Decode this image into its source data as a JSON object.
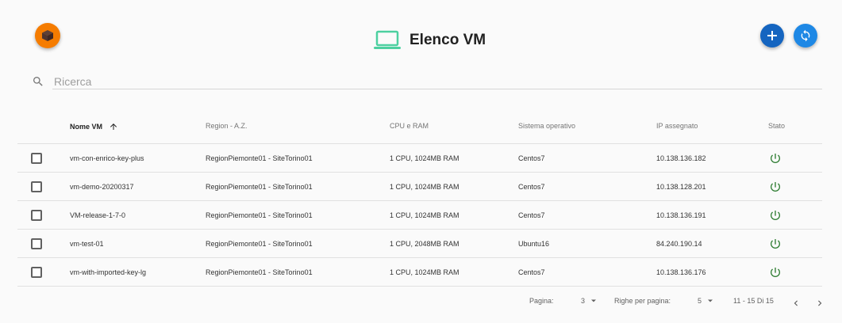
{
  "header": {
    "title": "Elenco VM"
  },
  "search": {
    "placeholder": "Ricerca"
  },
  "table": {
    "columns": [
      "Nome VM",
      "Region - A.Z.",
      "CPU e RAM",
      "Sistema operativo",
      "IP assegnato",
      "Stato"
    ],
    "rows": [
      {
        "name": "vm-con-enrico-key-plus",
        "region": "RegionPiemonte01 - SiteTorino01",
        "cpu_ram": "1 CPU, 1024MB RAM",
        "os": "Centos7",
        "ip": "10.138.136.182",
        "status": "power-on"
      },
      {
        "name": "vm-demo-20200317",
        "region": "RegionPiemonte01 - SiteTorino01",
        "cpu_ram": "1 CPU, 1024MB RAM",
        "os": "Centos7",
        "ip": "10.138.128.201",
        "status": "power-on"
      },
      {
        "name": "VM-release-1-7-0",
        "region": "RegionPiemonte01 - SiteTorino01",
        "cpu_ram": "1 CPU, 1024MB RAM",
        "os": "Centos7",
        "ip": "10.138.136.191",
        "status": "power-on"
      },
      {
        "name": "vm-test-01",
        "region": "RegionPiemonte01 - SiteTorino01",
        "cpu_ram": "1 CPU, 2048MB RAM",
        "os": "Ubuntu16",
        "ip": "84.240.190.14",
        "status": "power-on"
      },
      {
        "name": "vm-with-imported-key-lg",
        "region": "RegionPiemonte01 - SiteTorino01",
        "cpu_ram": "1 CPU, 1024MB RAM",
        "os": "Centos7",
        "ip": "10.138.136.176",
        "status": "power-on"
      }
    ]
  },
  "pagination": {
    "page_label": "Pagina:",
    "page_value": "3",
    "rows_per_page_label": "Righe per pagina:",
    "rows_per_page_value": "5",
    "range": "11 - 15 Di 15"
  },
  "colors": {
    "logo": "#f57c00",
    "title_icon": "#4dd0a0",
    "fab_add": "#1565c0",
    "fab_refresh": "#1e88e5",
    "status_on": "#2e7d32"
  },
  "icons": [
    "app-logo-icon",
    "laptop-icon",
    "plus-icon",
    "refresh-icon",
    "search-icon",
    "arrow-up-icon",
    "power-icon",
    "dropdown-icon",
    "chevron-left-icon",
    "chevron-right-icon"
  ]
}
